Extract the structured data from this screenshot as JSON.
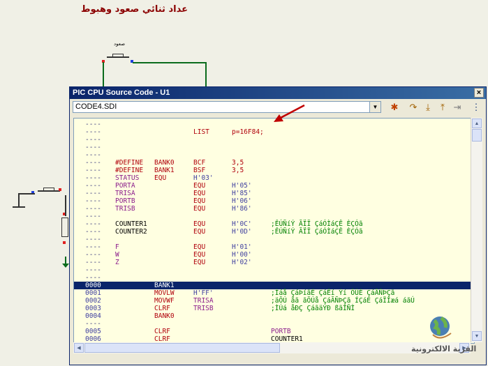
{
  "schematic": {
    "title": "عداد ثنائي صعود وهبوط",
    "button_label": "صعود"
  },
  "window": {
    "title": "PIC CPU Source Code - U1",
    "close_label": "×",
    "file_selector": {
      "value": "CODE4.SDI"
    }
  },
  "colors": {
    "text": "#000000",
    "directive": "#b0000b",
    "symbol": "#8b1c8b",
    "comment": "#008000",
    "number": "#4040a0",
    "highlight": "#0a246a"
  },
  "code": {
    "rows": [
      {
        "addr": "----",
        "c1": "",
        "c2": "",
        "c3": "",
        "c4": "",
        "c5": ""
      },
      {
        "addr": "----",
        "c1": "",
        "c2": "",
        "c3": "LIST",
        "c4": "p=16F84;",
        "c5": ""
      },
      {
        "addr": "----",
        "c1": "",
        "c2": "",
        "c3": "",
        "c4": "",
        "c5": ""
      },
      {
        "addr": "----",
        "c1": "",
        "c2": "",
        "c3": "",
        "c4": "",
        "c5": ""
      },
      {
        "addr": "----",
        "c1": "",
        "c2": "",
        "c3": "",
        "c4": "",
        "c5": ""
      },
      {
        "addr": "----",
        "c1": "#DEFINE",
        "c2": "BANK0",
        "c3": "BCF",
        "c4": "3,5",
        "c5": ""
      },
      {
        "addr": "----",
        "c1": "#DEFINE",
        "c2": "BANK1",
        "c3": "BSF",
        "c4": "3,5",
        "c5": ""
      },
      {
        "addr": "----",
        "c1": "STATUS",
        "c2": "EQU",
        "c3": "H'03'",
        "c4": "",
        "c5": ""
      },
      {
        "addr": "----",
        "c1": "PORTA",
        "c2": "",
        "c3": "EQU",
        "c4": "H'05'",
        "c5": ""
      },
      {
        "addr": "----",
        "c1": "TRISA",
        "c2": "",
        "c3": "EQU",
        "c4": "H'85'",
        "c5": ""
      },
      {
        "addr": "----",
        "c1": "PORTB",
        "c2": "",
        "c3": "EQU",
        "c4": "H'06'",
        "c5": ""
      },
      {
        "addr": "----",
        "c1": "TRISB",
        "c2": "",
        "c3": "EQU",
        "c4": "H'86'",
        "c5": ""
      },
      {
        "addr": "----",
        "c1": "",
        "c2": "",
        "c3": "",
        "c4": "",
        "c5": ""
      },
      {
        "addr": "----",
        "c1": "COUNTER1",
        "c2": "",
        "c3": "EQU",
        "c4": "H'0C'",
        "c5": ";ÊÚÑíÝ ÃÏÏ ÇáÓÌáÇÊ ÈÇÓã"
      },
      {
        "addr": "----",
        "c1": "COUNTER2",
        "c2": "",
        "c3": "EQU",
        "c4": "H'0D'",
        "c5": ";ÊÚÑíÝ ÃÏÏ ÇáÓÌáÇÊ ÈÇÓã"
      },
      {
        "addr": "----",
        "c1": "",
        "c2": "",
        "c3": "",
        "c4": "",
        "c5": ""
      },
      {
        "addr": "----",
        "c1": "F",
        "c2": "",
        "c3": "EQU",
        "c4": "H'01'",
        "c5": ""
      },
      {
        "addr": "----",
        "c1": "W",
        "c2": "",
        "c3": "EQU",
        "c4": "H'00'",
        "c5": ""
      },
      {
        "addr": "----",
        "c1": "Z",
        "c2": "",
        "c3": "EQU",
        "c4": "H'02'",
        "c5": ""
      },
      {
        "addr": "----",
        "c1": "",
        "c2": "",
        "c3": "",
        "c4": "",
        "c5": ""
      },
      {
        "addr": "----",
        "c1": "",
        "c2": "",
        "c3": "",
        "c4": "",
        "c5": ""
      },
      {
        "addr": "0000",
        "c1": "",
        "c2": "BANK1",
        "c3": "",
        "c4": "",
        "c5": ""
      },
      {
        "addr": "0001",
        "c1": "",
        "c2": "MOVLW",
        "c3": "H'FF'",
        "c4": "",
        "c5": ";Ìáå ÇáÞíãÉ ÇáÊí Ýí ÔÚÉ ÇáÃÑÞÇã"
      },
      {
        "addr": "0002",
        "c1": "",
        "c2": "MOVWF",
        "c3": "TRISA",
        "c4": "",
        "c5": ";äÖÚ åã ãÖÚå ÇáÃÑÞÇã ÍÇáÉ ÇáÏÎæá áãÚ"
      },
      {
        "addr": "0003",
        "c1": "",
        "c2": "CLRF",
        "c3": "TRISB",
        "c4": "",
        "c5": ";ÌÚá åÐÇ ÇáãäÝÐ ßãÎÑÌ"
      },
      {
        "addr": "0004",
        "c1": "",
        "c2": "BANK0",
        "c3": "",
        "c4": "",
        "c5": ""
      },
      {
        "addr": "----",
        "c1": "",
        "c2": "",
        "c3": "",
        "c4": "",
        "c5": ""
      },
      {
        "addr": "0005",
        "c1": "",
        "c2": "CLRF",
        "c3": "",
        "c4": "",
        "c5": "PORTB"
      },
      {
        "addr": "0006",
        "c1": "",
        "c2": "CLRF",
        "c3": "",
        "c4": "",
        "c5": "COUNTER1"
      }
    ],
    "current_row": "0000"
  },
  "watermark": {
    "text": "القرية الالكترونية"
  }
}
